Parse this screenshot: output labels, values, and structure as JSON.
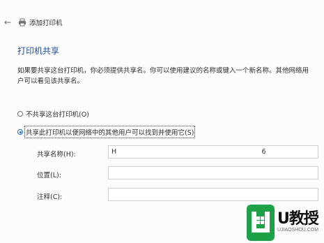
{
  "header": {
    "back_icon": "back-arrow-icon",
    "printer_icon": "printer-icon",
    "title": "添加打印机"
  },
  "heading": "打印机共享",
  "description": "如果要共享这台打印机，你必须提供共享名。你可以使用建议的名称或键入一个新名称。其他网络用户可以看见该共享名。",
  "options": [
    {
      "label": "不共享这台打印机(O)",
      "selected": false
    },
    {
      "label": "共享此打印机以便网络中的其他用户可以找到并使用它(S)",
      "selected": true
    }
  ],
  "fields": {
    "share_name": {
      "label": "共享名称(H):",
      "value": "H                                                                     6"
    },
    "location": {
      "label": "位置(L):",
      "value": ""
    },
    "comment": {
      "label": "注释(C):",
      "value": ""
    }
  },
  "watermark": {
    "brand": "U教授",
    "site": "UJIAOSHOU.COM",
    "logo_color": "#1ea046"
  },
  "colors": {
    "accent": "#1f4fa0",
    "radio_selected": "#1f66c9"
  }
}
